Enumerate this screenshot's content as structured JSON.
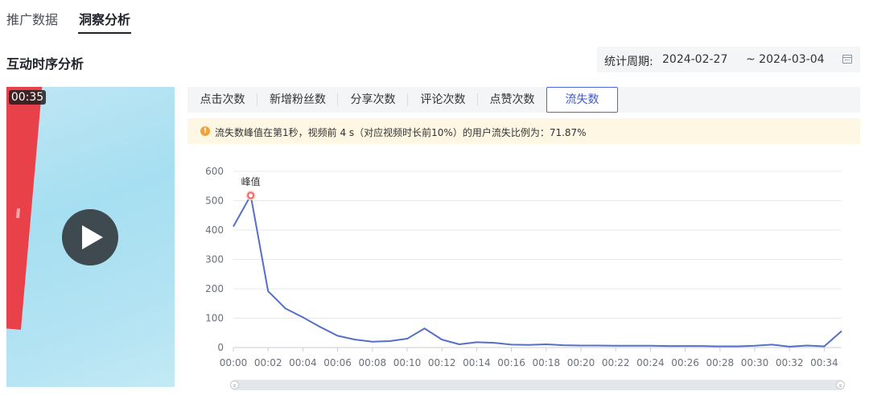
{
  "top_tabs": [
    {
      "label": "推广数据",
      "active": false
    },
    {
      "label": "洞察分析",
      "active": true
    }
  ],
  "section": {
    "title": "互动时序分析"
  },
  "period": {
    "label": "统计周期:",
    "start": "2024-02-27",
    "end": "~ 2024-03-04",
    "icon": "calendar-icon"
  },
  "video": {
    "duration": "00:35",
    "icon": "play-icon"
  },
  "metric_tabs": [
    {
      "label": "点击次数",
      "active": false
    },
    {
      "label": "新增粉丝数",
      "active": false
    },
    {
      "label": "分享次数",
      "active": false
    },
    {
      "label": "评论次数",
      "active": false
    },
    {
      "label": "点赞次数",
      "active": false
    },
    {
      "label": "流失数",
      "active": true
    }
  ],
  "notice": {
    "icon": "warning-icon",
    "text": "流失数峰值在第1秒，视频前 4 s（对应视频时长前10%）的用户流失比例为：71.87%"
  },
  "colors": {
    "accent": "#4d68d8",
    "line": "#5470c6",
    "peak": "#f2665f",
    "notice_bg": "#fdf7e3"
  },
  "chart_data": {
    "type": "line",
    "title": "",
    "xlabel": "",
    "ylabel": "",
    "ylim": [
      0,
      600
    ],
    "yticks": [
      "0",
      "100",
      "200",
      "300",
      "400",
      "500",
      "600"
    ],
    "xticks": [
      "00:00",
      "00:02",
      "00:04",
      "00:06",
      "00:08",
      "00:10",
      "00:12",
      "00:14",
      "00:16",
      "00:18",
      "00:20",
      "00:22",
      "00:24",
      "00:26",
      "00:28",
      "00:30",
      "00:32",
      "00:34"
    ],
    "series": [
      {
        "x": [
          0,
          1,
          2,
          3,
          4,
          5,
          6,
          7,
          8,
          9,
          10,
          11,
          12,
          13,
          14,
          15,
          16,
          17,
          18,
          19,
          20,
          21,
          22,
          23,
          24,
          25,
          26,
          27,
          28,
          29,
          30,
          31,
          32,
          33,
          34,
          35
        ],
        "values": [
          412,
          518,
          192,
          133,
          103,
          70,
          40,
          27,
          20,
          22,
          30,
          65,
          27,
          11,
          18,
          16,
          10,
          9,
          11,
          8,
          7,
          7,
          6,
          6,
          6,
          5,
          5,
          5,
          4,
          4,
          6,
          10,
          3,
          7,
          4,
          56
        ]
      }
    ],
    "annotation": {
      "label": "峰值",
      "x": 1,
      "y": 518
    },
    "grid": true
  }
}
